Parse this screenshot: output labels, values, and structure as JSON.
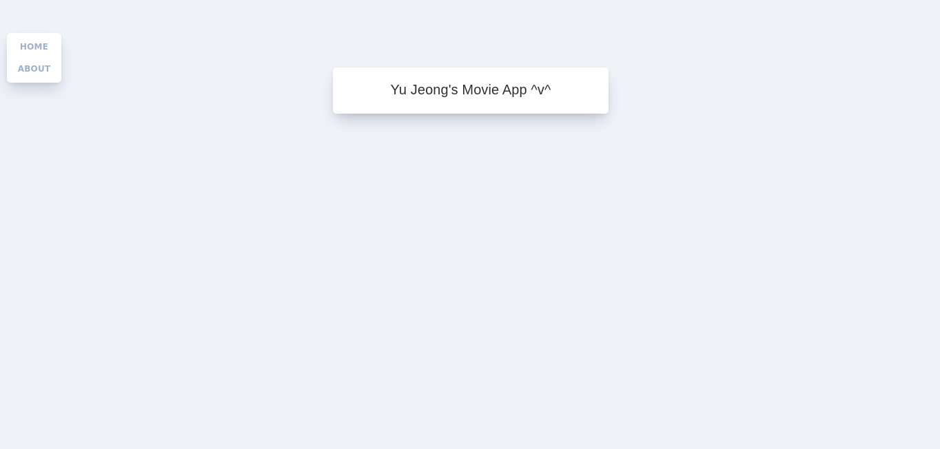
{
  "navigation": {
    "items": [
      {
        "label": "HOME"
      },
      {
        "label": "ABOUT"
      }
    ]
  },
  "header": {
    "title": "Yu Jeong's Movie App ^v^"
  },
  "colors": {
    "background": "#eff2f7",
    "card": "#ffffff",
    "nav_link": "#9fb0c8",
    "title_text": "#2f3033"
  }
}
